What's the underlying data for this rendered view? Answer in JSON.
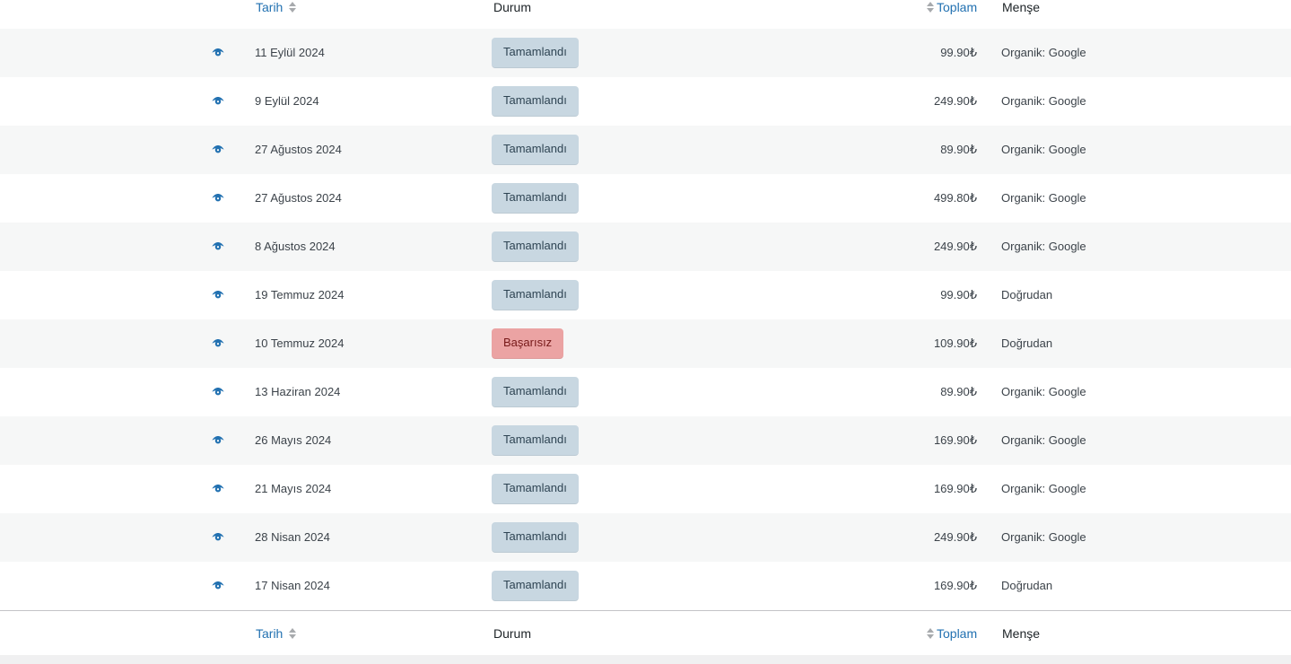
{
  "columns": {
    "date": "Tarih",
    "status": "Durum",
    "total": "Toplam",
    "origin": "Menşe"
  },
  "icons": {
    "view": "eye-icon",
    "sort": "sort-arrows-icon"
  },
  "colors": {
    "link": "#2271b1",
    "completed_bg": "#c8d7e1",
    "completed_text": "#2e4453",
    "failed_bg": "#eba3a3",
    "failed_text": "#761919",
    "alt_row": "#f6f7f7"
  },
  "orders": [
    {
      "date": "11 Eylül 2024",
      "status": "Tamamlandı",
      "state": "completed",
      "total": "99.90₺",
      "origin": "Organik: Google"
    },
    {
      "date": "9 Eylül 2024",
      "status": "Tamamlandı",
      "state": "completed",
      "total": "249.90₺",
      "origin": "Organik: Google"
    },
    {
      "date": "27 Ağustos 2024",
      "status": "Tamamlandı",
      "state": "completed",
      "total": "89.90₺",
      "origin": "Organik: Google"
    },
    {
      "date": "27 Ağustos 2024",
      "status": "Tamamlandı",
      "state": "completed",
      "total": "499.80₺",
      "origin": "Organik: Google"
    },
    {
      "date": "8 Ağustos 2024",
      "status": "Tamamlandı",
      "state": "completed",
      "total": "249.90₺",
      "origin": "Organik: Google"
    },
    {
      "date": "19 Temmuz 2024",
      "status": "Tamamlandı",
      "state": "completed",
      "total": "99.90₺",
      "origin": "Doğrudan"
    },
    {
      "date": "10 Temmuz 2024",
      "status": "Başarısız",
      "state": "failed",
      "total": "109.90₺",
      "origin": "Doğrudan"
    },
    {
      "date": "13 Haziran 2024",
      "status": "Tamamlandı",
      "state": "completed",
      "total": "89.90₺",
      "origin": "Organik: Google"
    },
    {
      "date": "26 Mayıs 2024",
      "status": "Tamamlandı",
      "state": "completed",
      "total": "169.90₺",
      "origin": "Organik: Google"
    },
    {
      "date": "21 Mayıs 2024",
      "status": "Tamamlandı",
      "state": "completed",
      "total": "169.90₺",
      "origin": "Organik: Google"
    },
    {
      "date": "28 Nisan 2024",
      "status": "Tamamlandı",
      "state": "completed",
      "total": "249.90₺",
      "origin": "Organik: Google"
    },
    {
      "date": "17 Nisan 2024",
      "status": "Tamamlandı",
      "state": "completed",
      "total": "169.90₺",
      "origin": "Doğrudan"
    }
  ]
}
